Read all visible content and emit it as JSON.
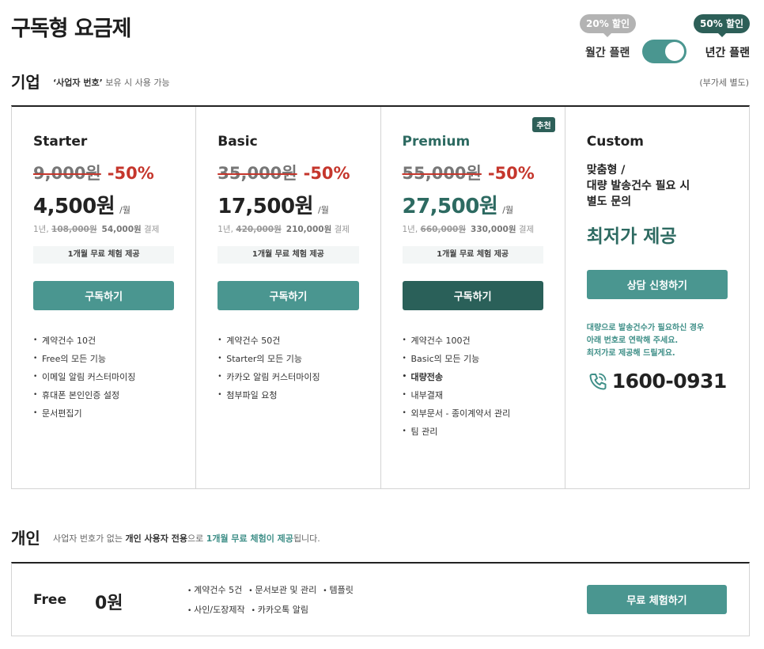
{
  "title": "구독형 요금제",
  "billing": {
    "monthly_badge": "20% 할인",
    "yearly_badge": "50% 할인",
    "monthly_label": "월간 플랜",
    "yearly_label": "년간 플랜",
    "yearly_selected": true
  },
  "business": {
    "title": "기업",
    "sub_pre": "‘사업자 번호’",
    "sub_post": " 보유 시 사용 가능",
    "vat": "(부가세 별도)"
  },
  "plans": [
    {
      "name": "Starter",
      "orig_price": "9,000원",
      "discount": "-50%",
      "price": "4,500원",
      "per": "/월",
      "yearly_pre": "1년,",
      "yearly_orig": "108,000원",
      "yearly_price": "54,000원",
      "yearly_post": "결제",
      "trial": "1개월 무료 체험 제공",
      "button": "구독하기",
      "features": [
        "계약건수 10건",
        "Free의 모든 기능",
        "이메일 알림 커스터마이징",
        "휴대폰 본인인증 설정",
        "문서편집기"
      ]
    },
    {
      "name": "Basic",
      "orig_price": "35,000원",
      "discount": "-50%",
      "price": "17,500원",
      "per": "/월",
      "yearly_pre": "1년,",
      "yearly_orig": "420,000원",
      "yearly_price": "210,000원",
      "yearly_post": "결제",
      "trial": "1개월 무료 체험 제공",
      "button": "구독하기",
      "features": [
        "계약건수 50건",
        "Starter의 모든 기능",
        "카카오 알림 커스터마이징",
        "첨부파일 요청"
      ]
    },
    {
      "name": "Premium",
      "badge": "추천",
      "orig_price": "55,000원",
      "discount": "-50%",
      "price": "27,500원",
      "per": "/월",
      "yearly_pre": "1년,",
      "yearly_orig": "660,000원",
      "yearly_price": "330,000원",
      "yearly_post": "결제",
      "trial": "1개월 무료 체험 제공",
      "button": "구독하기",
      "features": [
        "계약건수 100건",
        "Basic의 모든 기능",
        "대량전송",
        "내부결재",
        "외부문서 - 종이계약서 관리",
        "팀 관리"
      ]
    }
  ],
  "custom": {
    "name": "Custom",
    "desc1": "맞춤형 /",
    "desc2": "대량 발송건수 필요 시",
    "desc3": "별도 문의",
    "lowest": "최저가 제공",
    "button": "상담 신청하기",
    "note1": "대량으로 발송건수가 필요하신 경우",
    "note2": "아래 번호로 연락해 주세요.",
    "note3": "최저가로 제공해 드릴게요.",
    "phone": "1600-0931"
  },
  "personal": {
    "title": "개인",
    "sub_a": "사업자 번호가 없는 ",
    "sub_b": "개인 사용자 전용",
    "sub_c": "으로 ",
    "sub_d": "1개월 무료 체험이 제공",
    "sub_e": "됩니다.",
    "plan_name": "Free",
    "price": "0원",
    "features": [
      "계약건수 5건",
      "문서보관 및 관리",
      "템플릿",
      "사인/도장제작",
      "카카오톡 알림"
    ],
    "button": "무료 체험하기"
  },
  "colors": {
    "accent": "#4a9690",
    "accent_dark": "#2a6059",
    "discount_red": "#c5362c"
  }
}
